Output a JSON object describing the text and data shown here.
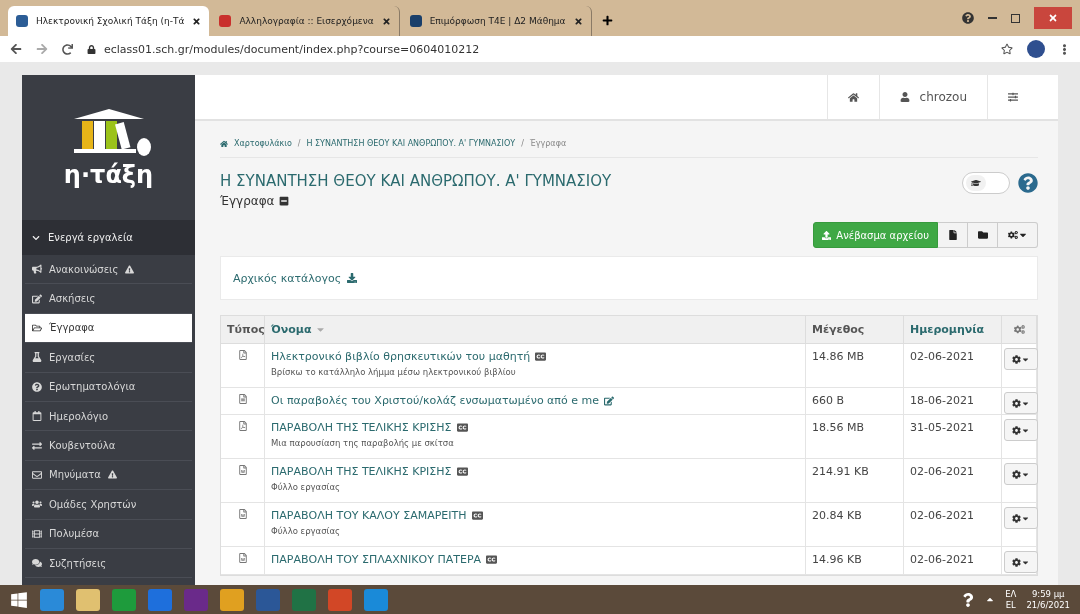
{
  "browser": {
    "tabs": [
      {
        "title": "Ηλεκτρονική Σχολική Τάξη (η-Τά",
        "selected": true,
        "kind": "etaxi"
      },
      {
        "title": "Αλληλογραφία :: Εισερχόμενα",
        "selected": false,
        "kind": "mail"
      },
      {
        "title": "Επιμόρφωση Τ4Ε | Δ2 Μάθημα",
        "selected": false,
        "kind": "t4e"
      }
    ],
    "address": "eclass01.sch.gr/modules/document/index.php?course=0604010212"
  },
  "sidebar": {
    "logo_text": "η·τάξη",
    "section": {
      "label": "Ενεργά εργαλεία",
      "expanded": true
    },
    "items": [
      {
        "label": "Ανακοινώσεις",
        "warning": true,
        "selected": false
      },
      {
        "label": "Ασκήσεις",
        "warning": false,
        "selected": false
      },
      {
        "label": "Έγγραφα",
        "warning": false,
        "selected": true
      },
      {
        "label": "Εργασίες",
        "warning": false,
        "selected": false
      },
      {
        "label": "Ερωτηματολόγια",
        "warning": false,
        "selected": false
      },
      {
        "label": "Ημερολόγιο",
        "warning": false,
        "selected": false
      },
      {
        "label": "Κουβεντούλα",
        "warning": false,
        "selected": false
      },
      {
        "label": "Μηνύματα",
        "warning": true,
        "selected": false
      },
      {
        "label": "Ομάδες Χρηστών",
        "warning": false,
        "selected": false
      },
      {
        "label": "Πολυμέσα",
        "warning": false,
        "selected": false
      },
      {
        "label": "Συζητήσεις",
        "warning": false,
        "selected": false
      }
    ]
  },
  "topbar": {
    "user": "chrozou"
  },
  "breadcrumb_separator": "/",
  "breadcrumb": [
    "Χαρτοφυλάκιο",
    "Η ΣΥΝΑΝΤΗΣΗ ΘΕΟΥ ΚΑΙ ΑΝΘΡΩΠΟΥ. Α' ΓΥΜΝΑΣΙΟΥ",
    "Έγγραφα"
  ],
  "course_title": "Η ΣΥΝΑΝΤΗΣΗ ΘΕΟΥ ΚΑΙ ΑΝΘΡΩΠΟΥ. Α' ΓΥΜΝΑΣΙΟΥ",
  "page_title": "Έγγραφα",
  "student_view": {
    "on": false
  },
  "upload_button": "Ανέβασμα αρχείου",
  "folder": "Αρχικός κατάλογος",
  "table": {
    "columns": [
      "Τύπος",
      "Όνομα",
      "Μέγεθος",
      "Ημερομηνία"
    ],
    "rows": [
      {
        "kind": "pdf",
        "name": "Ηλεκτρονικό βιβλίο θρησκευτικών του μαθητή",
        "licensed": true,
        "description": "Βρίσκω το κατάλληλο λήμμα μέσω ηλεκτρονικού βιβλίου",
        "size": "14.86 MB",
        "date": "02-06-2021"
      },
      {
        "kind": "link",
        "name": "Οι παραβολές του Χριστού/κολάζ ενσωματωμένο από e me",
        "editable": true,
        "size": "660 B",
        "date": "18-06-2021"
      },
      {
        "kind": "pdf",
        "name": "ΠΑΡΑΒΟΛΗ ΤΗΣ ΤΕΛΙΚΗΣ ΚΡΙΣΗΣ",
        "licensed": true,
        "description": "Μια παρουσίαση της παραβολής με σκίτσα",
        "size": "18.56 MB",
        "date": "31-05-2021"
      },
      {
        "kind": "word",
        "name": "ΠΑΡΑΒΟΛΗ ΤΗΣ ΤΕΛΙΚΗΣ ΚΡΙΣΗΣ",
        "licensed": true,
        "description": "Φύλλο εργασίας",
        "size": "214.91 KB",
        "date": "02-06-2021"
      },
      {
        "kind": "word",
        "name": "ΠΑΡΑΒΟΛΗ ΤΟΥ ΚΑΛΟΥ ΣΑΜΑΡΕΙΤΗ",
        "licensed": true,
        "description": "Φύλλο εργασίας",
        "size": "20.84 KB",
        "date": "02-06-2021"
      },
      {
        "kind": "word",
        "name": "ΠΑΡΑΒΟΛΗ ΤΟΥ ΣΠΛΑΧΝΙΚΟΥ ΠΑΤΕΡΑ",
        "licensed": true,
        "size": "14.96 KB",
        "date": "02-06-2021"
      }
    ]
  },
  "taskbar": {
    "lang_top": "ΕΛ",
    "lang_bottom": "EL",
    "time": "9:59 μμ",
    "date": "21/6/2021"
  }
}
